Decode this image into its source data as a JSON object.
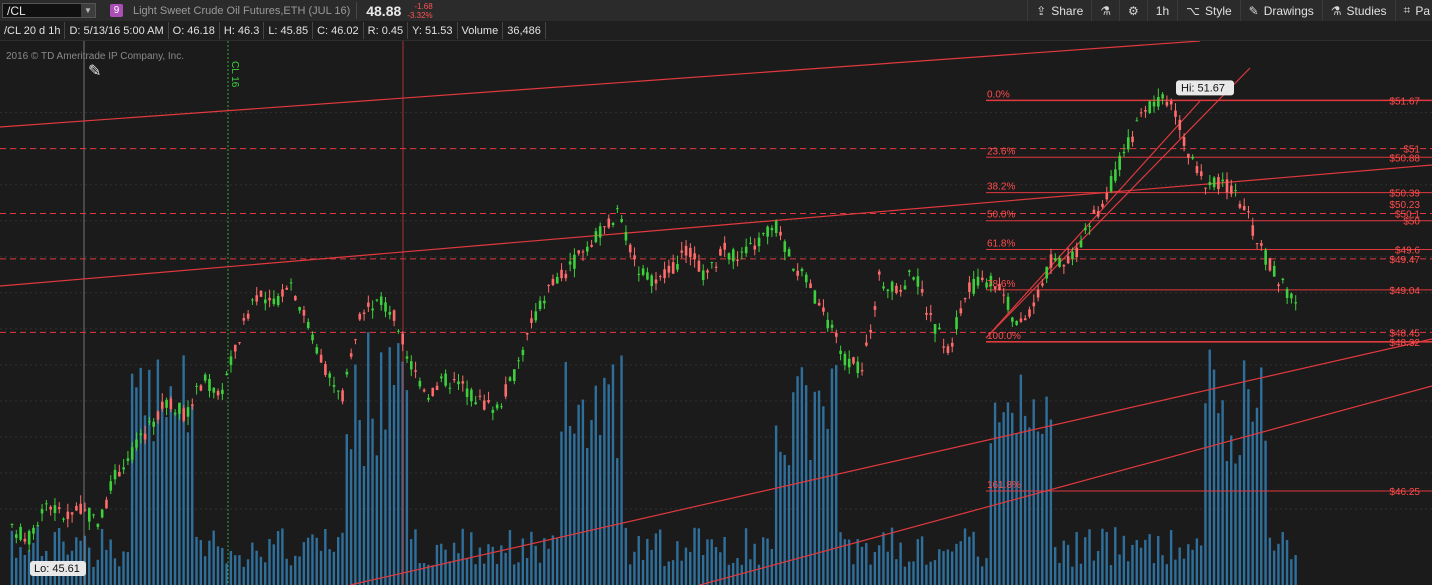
{
  "toolbar": {
    "symbol": "/CL",
    "link_number": "9",
    "description": "Light Sweet Crude Oil Futures,ETH (JUL 16)",
    "last_price": "48.88",
    "net_change": "-1.68",
    "pct_change": "-3.32%",
    "buttons": {
      "share": "Share",
      "interval": "1h",
      "style": "Style",
      "drawings": "Drawings",
      "studies": "Studies",
      "more": "Pa"
    }
  },
  "info_bar": {
    "symbol_period": "/CL 20 d 1h",
    "date": "D: 5/13/16 5:00 AM",
    "open": "O: 46.18",
    "high": "H: 46.3",
    "low": "L: 45.85",
    "close": "C: 46.02",
    "range": "R: 0.45",
    "y": "Y: 51.53",
    "volume_label": "Volume",
    "volume_value": "36,486"
  },
  "watermark": "2016 © TD Ameritrade IP Company, Inc.",
  "contract_marker": "CL 16",
  "hi_label": "Hi: 51.67",
  "lo_label": "Lo: 45.61",
  "colors": {
    "up": "#3cd13c",
    "down": "#ff6b6b",
    "volume": "#2f6f9c",
    "drawing": "#e0393e",
    "background": "#1b1b1b"
  },
  "chart_data": {
    "type": "candlestick",
    "instrument": "/CL",
    "interval": "1h",
    "ylim": [
      45.5,
      52.05
    ],
    "high": 51.67,
    "low": 45.61,
    "last": 48.88,
    "grid": true,
    "price_levels": [
      {
        "label": "$51.67",
        "value": 51.67
      },
      {
        "label": "$51",
        "value": 51.0
      },
      {
        "label": "$50.88",
        "value": 50.88
      },
      {
        "label": "$50.39",
        "value": 50.39
      },
      {
        "label": "$50.23",
        "value": 50.23
      },
      {
        "label": "$50.1",
        "value": 50.1
      },
      {
        "label": "$50",
        "value": 50.0
      },
      {
        "label": "$49.6",
        "value": 49.6
      },
      {
        "label": "$49.47",
        "value": 49.47
      },
      {
        "label": "$49.04",
        "value": 49.04
      },
      {
        "label": "$48.45",
        "value": 48.45
      },
      {
        "label": "$48.32",
        "value": 48.32
      },
      {
        "label": "$46.25",
        "value": 46.25
      }
    ],
    "fibonacci_levels": [
      {
        "label": "0.0%",
        "value": 51.67
      },
      {
        "label": "23.6%",
        "value": 50.88
      },
      {
        "label": "38.2%",
        "value": 50.39
      },
      {
        "label": "50.0%",
        "value": 50.0
      },
      {
        "label": "61.8%",
        "value": 49.6
      },
      {
        "label": "78.6%",
        "value": 49.04
      },
      {
        "label": "100.0%",
        "value": 48.32
      },
      {
        "label": "161.8%",
        "value": 46.25
      }
    ],
    "dashed_levels": [
      51.0,
      50.1,
      49.47,
      48.45
    ],
    "price_path": [
      45.7,
      45.61,
      46.1,
      45.9,
      46.0,
      45.8,
      46.5,
      46.8,
      47.2,
      47.5,
      47.3,
      47.8,
      47.6,
      48.3,
      49.0,
      48.8,
      49.2,
      48.6,
      48.0,
      47.5,
      48.6,
      48.9,
      48.7,
      48.0,
      47.6,
      47.8,
      47.7,
      47.5,
      47.4,
      47.9,
      48.6,
      49.1,
      49.3,
      49.6,
      49.85,
      50.1,
      49.4,
      49.1,
      49.3,
      49.6,
      49.2,
      49.6,
      49.5,
      49.7,
      49.95,
      49.4,
      49.1,
      48.6,
      48.1,
      47.9,
      49.2,
      49.0,
      49.3,
      48.6,
      48.2,
      49.0,
      49.2,
      49.1,
      48.5,
      48.9,
      49.5,
      49.4,
      49.9,
      50.3,
      50.9,
      51.4,
      51.67,
      51.6,
      50.8,
      50.5,
      50.5,
      50.2,
      49.6,
      49.2,
      48.88
    ]
  }
}
